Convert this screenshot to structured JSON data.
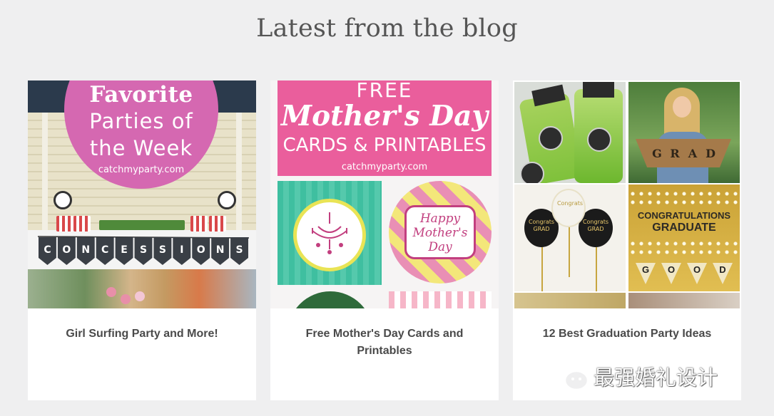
{
  "section": {
    "title": "Latest from the blog"
  },
  "posts": [
    {
      "caption_lines": [
        "Girl Surfing Party and More!"
      ],
      "thumbnail": {
        "headline": "Favorite",
        "line2": "Parties of",
        "line3": "the Week",
        "site": "catchmyparty.com",
        "bunting_letters": [
          "C",
          "O",
          "N",
          "C",
          "E",
          "S",
          "S",
          "I",
          "O",
          "N",
          "S"
        ]
      }
    },
    {
      "caption_lines": [
        "Free Mother's Day Cards and",
        "Printables"
      ],
      "thumbnail": {
        "line1": "FREE",
        "line2": "Mother's Day",
        "line3": "CARDS & PRINTABLES",
        "site": "catchmyparty.com",
        "tag_lines": [
          "Happy",
          "Mother's",
          "Day"
        ]
      }
    },
    {
      "caption_lines": [
        "12 Best Graduation Party Ideas"
      ],
      "thumbnail": {
        "banner_letters": [
          "G",
          "R",
          "A",
          "D"
        ],
        "balloon_text": [
          "Congrats",
          "GRAD"
        ],
        "sign_line1": "CONGRATULATIONS",
        "sign_line2": "GRADUATE",
        "pennant_letters": [
          "G",
          "O",
          "O",
          "D"
        ]
      }
    }
  ],
  "watermark": {
    "text": "最强婚礼设计",
    "icon": "wechat-icon"
  },
  "colors": {
    "page_background": "#efeff0",
    "card_background": "#ffffff",
    "title_text": "#555555",
    "caption_text": "#4a4a4a",
    "favorite_circle": "#d568b1",
    "mothers_day_pink": "#ea5e9c"
  }
}
